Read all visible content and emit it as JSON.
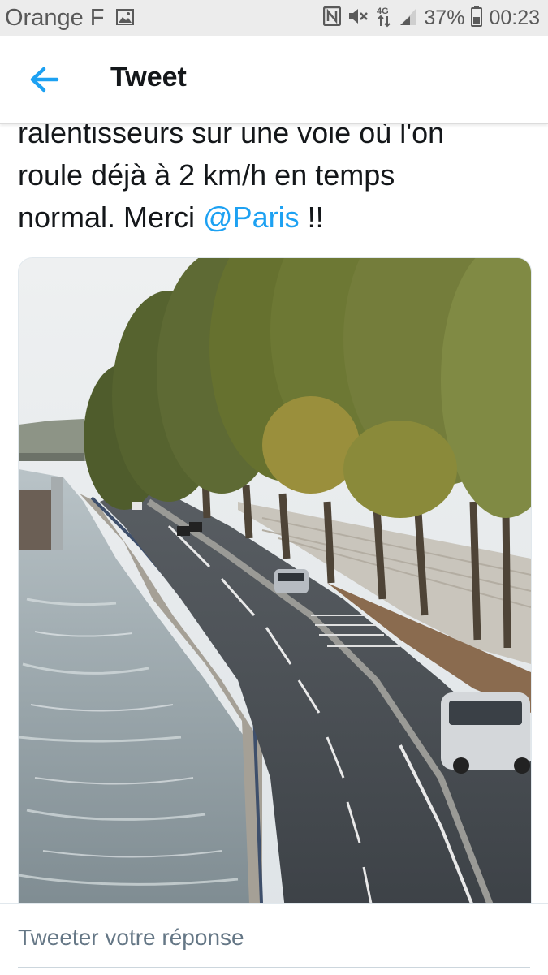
{
  "status_bar": {
    "carrier": "Orange F",
    "network": "4G",
    "battery": "37%",
    "time": "00:23",
    "icons": [
      "gallery-icon",
      "nfc-icon",
      "mute-icon",
      "data-arrows-icon",
      "signal-icon",
      "battery-icon"
    ]
  },
  "app_bar": {
    "back_icon": "arrow-left-icon",
    "title": "Tweet",
    "accent_color": "#1da1f2"
  },
  "tweet": {
    "line1": "ralentisseurs sur une voie où l'on",
    "line2": "roule déjà à 2 km/h en temps",
    "line3_prefix": "normal. Merci ",
    "mention": "@Paris",
    "line3_suffix": " !!"
  },
  "media": {
    "type": "photo",
    "subject": "riverside-road-with-trees"
  },
  "reply": {
    "placeholder": "Tweeter votre réponse"
  }
}
